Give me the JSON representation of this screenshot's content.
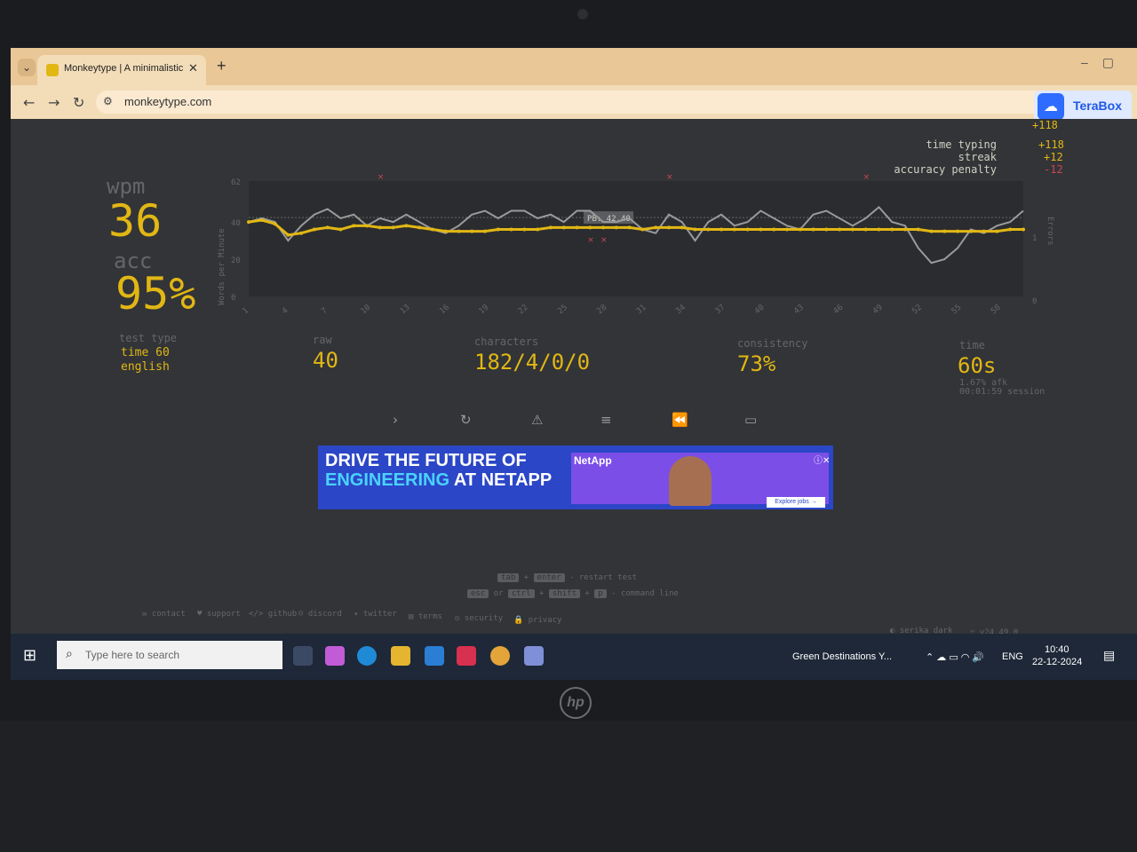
{
  "browser": {
    "tab_title": "Monkeytype | A minimalistic, cu",
    "url": "monkeytype.com",
    "extension_label": "TeraBox"
  },
  "xp": {
    "total_partial": "+118",
    "rows": [
      {
        "label": "time typing",
        "value": "+118"
      },
      {
        "label": "streak",
        "value": "+12"
      },
      {
        "label": "accuracy penalty",
        "value": "-12"
      }
    ]
  },
  "result": {
    "wpm_label": "wpm",
    "wpm": "36",
    "acc_label": "acc",
    "acc": "95%",
    "test_type_label": "test type",
    "test_type_mode": "time 60",
    "test_type_lang": "english",
    "raw_label": "raw",
    "raw": "40",
    "characters_label": "characters",
    "characters": "182/4/0/0",
    "consistency_label": "consistency",
    "consistency": "73%",
    "time_label": "time",
    "time": "60s",
    "afk": "1.67% afk",
    "session": "00:01:59 session"
  },
  "chart_data": {
    "type": "line",
    "ylabel": "Words per Minute",
    "y2label": "Errors",
    "ylim": [
      0,
      62
    ],
    "yticks": [
      "0",
      "20",
      "40",
      "62"
    ],
    "y2ticks": [
      "0",
      "1"
    ],
    "x": [
      1,
      2,
      3,
      4,
      5,
      6,
      7,
      8,
      9,
      10,
      11,
      12,
      13,
      14,
      15,
      16,
      17,
      18,
      19,
      20,
      21,
      22,
      23,
      24,
      25,
      26,
      27,
      28,
      29,
      30,
      31,
      32,
      33,
      34,
      35,
      36,
      37,
      38,
      39,
      40,
      41,
      42,
      43,
      44,
      45,
      46,
      47,
      48,
      49,
      50,
      51,
      52,
      53,
      54,
      55,
      56,
      57,
      58,
      59,
      60
    ],
    "xticks": [
      "1",
      "4",
      "7",
      "10",
      "13",
      "16",
      "19",
      "22",
      "25",
      "28",
      "31",
      "34",
      "37",
      "40",
      "43",
      "46",
      "49",
      "52",
      "55",
      "58"
    ],
    "pb_label": "PB: 42.40",
    "pb_value": 42.4,
    "series": [
      {
        "name": "wpm",
        "color": "#e2b714",
        "values": [
          40,
          41,
          39,
          33,
          34,
          36,
          37,
          36,
          38,
          38,
          37,
          37,
          38,
          37,
          36,
          35,
          35,
          35,
          35,
          36,
          36,
          36,
          36,
          37,
          37,
          37,
          37,
          37,
          37,
          37,
          36,
          37,
          37,
          37,
          36,
          36,
          36,
          36,
          36,
          36,
          36,
          36,
          36,
          36,
          36,
          36,
          36,
          36,
          36,
          36,
          36,
          36,
          35,
          35,
          35,
          35,
          35,
          35,
          36,
          36
        ]
      },
      {
        "name": "raw",
        "color": "#9a9a9a",
        "values": [
          40,
          42,
          40,
          30,
          38,
          44,
          47,
          42,
          44,
          38,
          42,
          40,
          44,
          40,
          36,
          34,
          38,
          44,
          46,
          42,
          46,
          46,
          42,
          44,
          40,
          46,
          46,
          40,
          40,
          42,
          36,
          34,
          44,
          40,
          30,
          40,
          44,
          38,
          40,
          46,
          42,
          38,
          36,
          44,
          46,
          42,
          38,
          42,
          48,
          40,
          38,
          26,
          18,
          20,
          26,
          36,
          34,
          38,
          40,
          46
        ]
      }
    ],
    "errors": [
      {
        "x": 11,
        "y": 1
      },
      {
        "x": 27,
        "y": 1
      },
      {
        "x": 28,
        "y": 1
      },
      {
        "x": 33,
        "y": 1
      },
      {
        "x": 48,
        "y": 1
      }
    ]
  },
  "buttons": [
    {
      "name": "next-test-icon",
      "glyph": "›"
    },
    {
      "name": "restart-icon",
      "glyph": "↻"
    },
    {
      "name": "warning-icon",
      "glyph": "⚠"
    },
    {
      "name": "words-history-icon",
      "glyph": "≡"
    },
    {
      "name": "replay-icon",
      "glyph": "⏪"
    },
    {
      "name": "screenshot-icon",
      "glyph": "▭"
    }
  ],
  "ad": {
    "line1": "DRIVE THE FUTURE OF",
    "line2a": "ENGINEERING",
    "line2b": " AT NETAPP",
    "brand": "NetApp",
    "cta": "Explore jobs →"
  },
  "hints": {
    "tab": "tab",
    "enter": "enter",
    "restart_text": "- restart test",
    "esc": "esc",
    "or": "or",
    "ctrl": "ctrl",
    "shift": "shift",
    "p": "p",
    "command_text": "- command line"
  },
  "footer": {
    "links": [
      "contact",
      "support",
      "github",
      "discord",
      "twitter",
      "terms",
      "security",
      "privacy"
    ],
    "theme": "serika dark",
    "version": "v24.49.0"
  },
  "taskbar": {
    "search_placeholder": "Type here to search",
    "media_title": "Green Destinations Y...",
    "language": "ENG",
    "time": "10:40",
    "date": "22-12-2024"
  }
}
